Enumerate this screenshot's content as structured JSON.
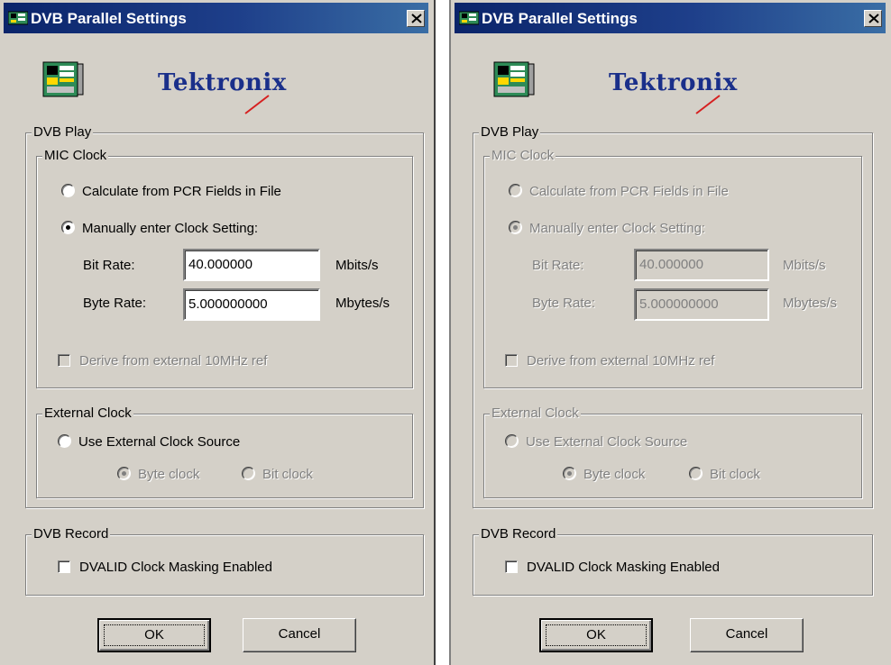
{
  "panels": [
    {
      "id": "enabled",
      "title": "DVB Parallel Settings",
      "logo": "Tektronix",
      "dvb_play": {
        "label": "DVB Play",
        "mic_clock": {
          "label": "MIC Clock",
          "calc_from_pcr": "Calculate from PCR Fields in File",
          "manual_entry": "Manually enter Clock Setting:",
          "bit_rate_label": "Bit Rate:",
          "bit_rate_value": "40.000000",
          "bit_rate_unit": "Mbits/s",
          "byte_rate_label": "Byte Rate:",
          "byte_rate_value": "5.000000000",
          "byte_rate_unit": "Mbytes/s",
          "derive_ext": "Derive from external 10MHz ref"
        },
        "external_clock": {
          "label": "External Clock",
          "use_external": "Use External Clock Source",
          "byte_clock": "Byte clock",
          "bit_clock": "Bit clock"
        }
      },
      "dvb_record": {
        "label": "DVB Record",
        "dvalid": "DVALID Clock Masking Enabled"
      },
      "ok": "OK",
      "cancel": "Cancel"
    },
    {
      "id": "disabled",
      "title": "DVB Parallel Settings",
      "logo": "Tektronix",
      "dvb_play": {
        "label": "DVB Play",
        "mic_clock": {
          "label": "MIC Clock",
          "calc_from_pcr": "Calculate from PCR Fields in File",
          "manual_entry": "Manually enter Clock Setting:",
          "bit_rate_label": "Bit Rate:",
          "bit_rate_value": "40.000000",
          "bit_rate_unit": "Mbits/s",
          "byte_rate_label": "Byte Rate:",
          "byte_rate_value": "5.000000000",
          "byte_rate_unit": "Mbytes/s",
          "derive_ext": "Derive from external 10MHz ref"
        },
        "external_clock": {
          "label": "External Clock",
          "use_external": "Use External Clock Source",
          "byte_clock": "Byte clock",
          "bit_clock": "Bit clock"
        }
      },
      "dvb_record": {
        "label": "DVB Record",
        "dvalid": "DVALID Clock Masking Enabled"
      },
      "ok": "OK",
      "cancel": "Cancel"
    }
  ],
  "icons": {
    "app": "app-card-icon",
    "close": "close-icon",
    "card": "circuit-card-icon",
    "logo_mark": "logo-slash-icon"
  },
  "colors": {
    "titlebar": "#0a246a",
    "face": "#d4d0c8",
    "logo": "#1a2f8a",
    "logo_slash": "#d62020"
  }
}
